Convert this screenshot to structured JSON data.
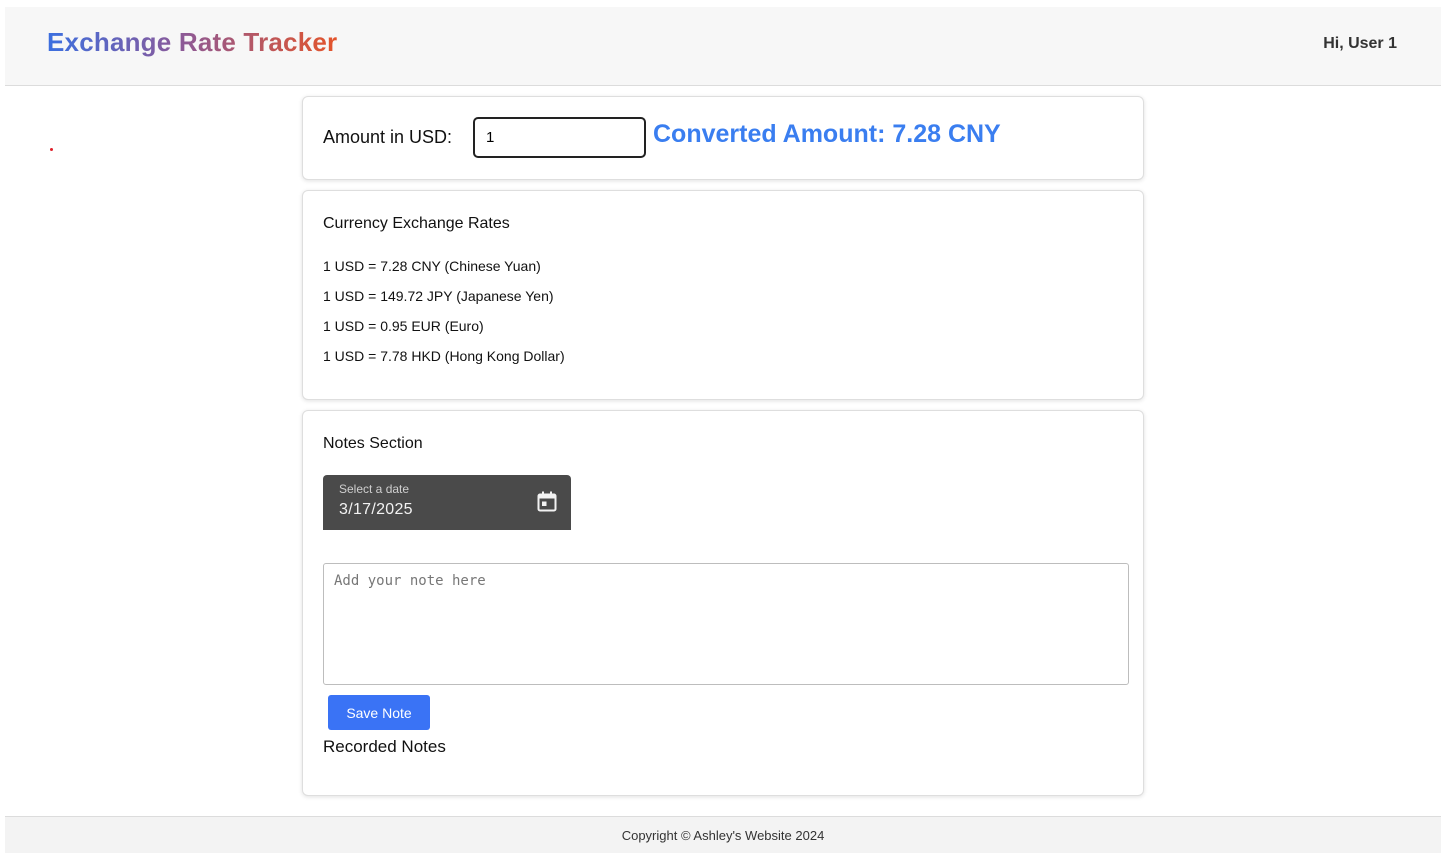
{
  "header": {
    "title": "Exchange Rate Tracker",
    "greeting": "Hi, User 1"
  },
  "converter": {
    "label": "Amount in USD:",
    "amount_value": "1",
    "converted_text": "Converted Amount: 7.28 CNY"
  },
  "rates": {
    "title": "Currency Exchange Rates",
    "items": [
      "1 USD = 7.28 CNY (Chinese Yuan)",
      "1 USD = 149.72 JPY (Japanese Yen)",
      "1 USD = 0.95 EUR (Euro)",
      "1 USD = 7.78 HKD (Hong Kong Dollar)"
    ]
  },
  "notes": {
    "title": "Notes Section",
    "date_label": "Select a date",
    "date_value": "3/17/2025",
    "note_placeholder": "Add your note here",
    "save_label": "Save Note",
    "recorded_title": "Recorded Notes",
    "calendar_icon": "calendar-icon"
  },
  "footer": {
    "text": "Copyright © Ashley's Website 2024"
  },
  "colors": {
    "accent": "#3a7ef0",
    "button": "#3a73f5",
    "date_field_bg": "#4a4a4a"
  }
}
